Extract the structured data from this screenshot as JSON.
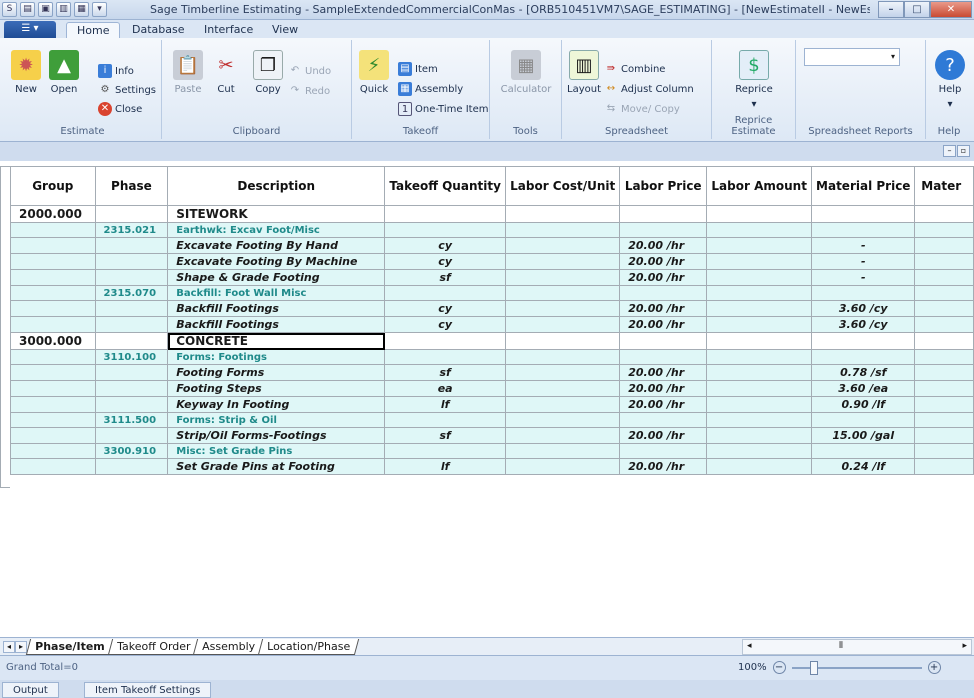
{
  "window": {
    "title": "Sage Timberline Estimating - SampleExtendedCommercialConMas - [ORB510451VM7\\SAGE_ESTIMATING] - [NewEstimateII - NewEstimateD..."
  },
  "ribbon_tabs": [
    "Home",
    "Database",
    "Interface",
    "View"
  ],
  "groups": {
    "estimate": {
      "label": "Estimate",
      "new": "New",
      "open": "Open",
      "info": "Info",
      "settings": "Settings",
      "close": "Close"
    },
    "clipboard": {
      "label": "Clipboard",
      "paste": "Paste",
      "cut": "Cut",
      "copy": "Copy",
      "undo": "Undo",
      "redo": "Redo"
    },
    "takeoff": {
      "label": "Takeoff",
      "quick": "Quick",
      "item": "Item",
      "assembly": "Assembly",
      "one_time": "One-Time Item"
    },
    "tools": {
      "label": "Tools",
      "calculator": "Calculator"
    },
    "spreadsheet": {
      "label": "Spreadsheet",
      "layout": "Layout",
      "combine": "Combine",
      "adjust_column": "Adjust Column",
      "move_copy": "Move/ Copy"
    },
    "reprice": {
      "label": "Reprice Estimate",
      "reprice": "Reprice"
    },
    "reports": {
      "label": "Spreadsheet Reports"
    },
    "help": {
      "label": "Help",
      "help": "Help"
    }
  },
  "columns": [
    "Group",
    "Phase",
    "Description",
    "Takeoff Quantity",
    "Labor Cost/Unit",
    "Labor Price",
    "Labor Amount",
    "Material Price",
    "Mater"
  ],
  "rows": [
    {
      "type": "hdr",
      "group": "2000.000",
      "phase": "",
      "desc": "SITEWORK",
      "qty": "",
      "lprice": "",
      "mprice": ""
    },
    {
      "type": "sub",
      "group": "",
      "phase": "2315.021",
      "desc": "Earthwk: Excav Foot/Misc",
      "qty": "",
      "lprice": "",
      "mprice": ""
    },
    {
      "type": "item",
      "group": "",
      "phase": "",
      "desc": "Excavate Footing By Hand",
      "qty": "cy",
      "lprice": "20.00  /hr",
      "mprice": "-"
    },
    {
      "type": "item",
      "group": "",
      "phase": "",
      "desc": "Excavate Footing By Machine",
      "qty": "cy",
      "lprice": "20.00  /hr",
      "mprice": "-"
    },
    {
      "type": "item",
      "group": "",
      "phase": "",
      "desc": "Shape & Grade Footing",
      "qty": "sf",
      "lprice": "20.00  /hr",
      "mprice": "-"
    },
    {
      "type": "sub",
      "group": "",
      "phase": "2315.070",
      "desc": "Backfill: Foot Wall Misc",
      "qty": "",
      "lprice": "",
      "mprice": ""
    },
    {
      "type": "item",
      "group": "",
      "phase": "",
      "desc": "Backfill Footings",
      "qty": "cy",
      "lprice": "20.00  /hr",
      "mprice": "3.60  /cy"
    },
    {
      "type": "item",
      "group": "",
      "phase": "",
      "desc": "Backfill Footings",
      "qty": "cy",
      "lprice": "20.00  /hr",
      "mprice": "3.60  /cy"
    },
    {
      "type": "hdr",
      "group": "3000.000",
      "phase": "",
      "desc": "CONCRETE",
      "qty": "",
      "lprice": "",
      "mprice": ""
    },
    {
      "type": "sub",
      "group": "",
      "phase": "3110.100",
      "desc": "Forms: Footings",
      "qty": "",
      "lprice": "",
      "mprice": ""
    },
    {
      "type": "item",
      "group": "",
      "phase": "",
      "desc": "Footing Forms",
      "qty": "sf",
      "lprice": "20.00  /hr",
      "mprice": "0.78  /sf"
    },
    {
      "type": "item",
      "group": "",
      "phase": "",
      "desc": "Footing Steps",
      "qty": "ea",
      "lprice": "20.00  /hr",
      "mprice": "3.60  /ea"
    },
    {
      "type": "item",
      "group": "",
      "phase": "",
      "desc": "Keyway In Footing",
      "qty": "lf",
      "lprice": "20.00  /hr",
      "mprice": "0.90  /lf"
    },
    {
      "type": "sub",
      "group": "",
      "phase": "3111.500",
      "desc": "Forms: Strip & Oil",
      "qty": "",
      "lprice": "",
      "mprice": ""
    },
    {
      "type": "item",
      "group": "",
      "phase": "",
      "desc": "Strip/Oil Forms-Footings",
      "qty": "sf",
      "lprice": "20.00  /hr",
      "mprice": "15.00  /gal"
    },
    {
      "type": "sub",
      "group": "",
      "phase": "3300.910",
      "desc": "Misc: Set Grade Pins",
      "qty": "",
      "lprice": "",
      "mprice": ""
    },
    {
      "type": "item",
      "group": "",
      "phase": "",
      "desc": "Set Grade Pins at Footing",
      "qty": "lf",
      "lprice": "20.00  /hr",
      "mprice": "0.24  /lf"
    }
  ],
  "sheet_tabs": [
    "Phase/Item",
    "Takeoff Order",
    "Assembly",
    "Location/Phase"
  ],
  "status": {
    "grand_total": "Grand Total=0",
    "zoom": "100%"
  },
  "bottom_tabs": [
    "Output",
    "Item Takeoff Settings"
  ]
}
